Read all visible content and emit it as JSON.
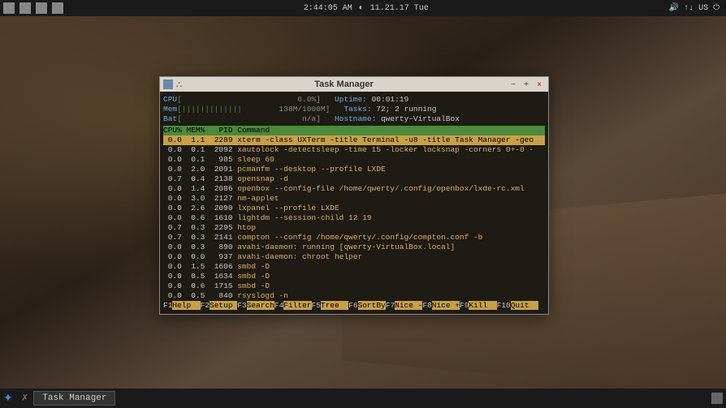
{
  "top_panel": {
    "time": "2:44:05 AM",
    "date": "11.21.17 Tue",
    "locale": "US"
  },
  "bottom_panel": {
    "task_label": "Task Manager"
  },
  "window": {
    "title": "Task Manager",
    "meters": {
      "cpu_label": "CPU",
      "cpu_bar": "[",
      "cpu_bar_end": "0.0%]",
      "mem_label": "Mem",
      "mem_bar": "[|||||||||||||",
      "mem_val": "138M/1000M]",
      "bat_label": "Bat",
      "bat_bar": "[",
      "bat_val": "n/a]",
      "uptime_label": "Uptime:",
      "uptime_val": "00:01:19",
      "tasks_label": "Tasks:",
      "tasks_val": "72; 2 running",
      "host_label": "Hostname:",
      "host_val": "qwerty-VirtualBox"
    },
    "columns": {
      "cpu": "CPU%",
      "mem": "MEM%",
      "pid": "PID",
      "cmd": "Command"
    },
    "processes": [
      {
        "cpu": "0.0",
        "mem": "1.1",
        "pid": "2289",
        "cmd": "xterm -class UXTerm -title Terminal -u8 -title Task Manager -geo",
        "hl": true
      },
      {
        "cpu": "0.0",
        "mem": "0.1",
        "pid": "2092",
        "cmd": "xautolock -detectsleep -time 15 -locker locksnap -corners 0+-0 -"
      },
      {
        "cpu": "0.0",
        "mem": "0.1",
        "pid": "985",
        "cmd": "sleep 60"
      },
      {
        "cpu": "0.0",
        "mem": "2.0",
        "pid": "2091",
        "cmd": "pcmanfm --desktop --profile LXDE"
      },
      {
        "cpu": "0.7",
        "mem": "0.4",
        "pid": "2138",
        "cmd": "opensnap -d"
      },
      {
        "cpu": "0.0",
        "mem": "1.4",
        "pid": "2086",
        "cmd": "openbox --config-file /home/qwerty/.config/openbox/lxde-rc.xml"
      },
      {
        "cpu": "0.0",
        "mem": "3.0",
        "pid": "2127",
        "cmd": "nm-applet"
      },
      {
        "cpu": "0.0",
        "mem": "2.6",
        "pid": "2090",
        "cmd": "lxpanel --profile LXDE"
      },
      {
        "cpu": "0.0",
        "mem": "0.6",
        "pid": "1610",
        "cmd": "lightdm --session-child 12 19"
      },
      {
        "cpu": "0.7",
        "mem": "0.3",
        "pid": "2295",
        "cmd": "htop"
      },
      {
        "cpu": "0.7",
        "mem": "0.3",
        "pid": "2141",
        "cmd": "compton --config /home/qwerty/.config/compton.conf -b"
      },
      {
        "cpu": "0.0",
        "mem": "0.3",
        "pid": "890",
        "cmd": "avahi-daemon: running [qwerty-VirtualBox.local]"
      },
      {
        "cpu": "0.0",
        "mem": "0.0",
        "pid": "937",
        "cmd": "avahi-daemon: chroot helper"
      },
      {
        "cpu": "0.0",
        "mem": "1.5",
        "pid": "1606",
        "cmd": "smbd -D"
      },
      {
        "cpu": "0.0",
        "mem": "0.5",
        "pid": "1634",
        "cmd": "smbd -D"
      },
      {
        "cpu": "0.0",
        "mem": "0.6",
        "pid": "1715",
        "cmd": "smbd -D"
      },
      {
        "cpu": "0.0",
        "mem": "0.5",
        "pid": "840",
        "cmd": "rsyslogd -n"
      }
    ],
    "fn": [
      {
        "key": "F1",
        "label": "Help  "
      },
      {
        "key": "F2",
        "label": "Setup "
      },
      {
        "key": "F3",
        "label": "Search"
      },
      {
        "key": "F4",
        "label": "Filter"
      },
      {
        "key": "F5",
        "label": "Tree  "
      },
      {
        "key": "F6",
        "label": "SortBy"
      },
      {
        "key": "F7",
        "label": "Nice -"
      },
      {
        "key": "F8",
        "label": "Nice +"
      },
      {
        "key": "F9",
        "label": "Kill  "
      },
      {
        "key": "F10",
        "label": "Quit  "
      }
    ]
  }
}
